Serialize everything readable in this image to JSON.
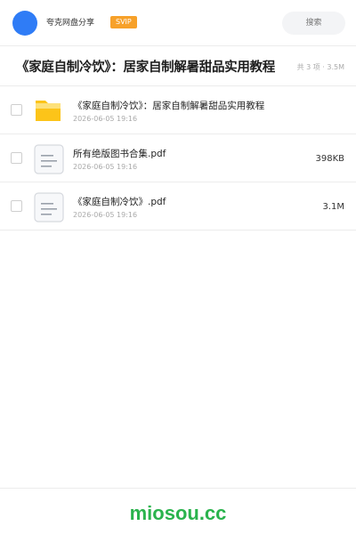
{
  "header": {
    "brand_name": "夸克网盘分享",
    "badge": "SVIP",
    "search_placeholder": "搜索"
  },
  "folder": {
    "title": "《家庭自制冷饮》：居家自制解暑甜品实用教程",
    "meta": "共 3 项 · 3.5M"
  },
  "files": [
    {
      "type": "folder",
      "name": "《家庭自制冷饮》：居家自制解暑甜品实用教程",
      "date": "2026-06-05 19:16",
      "size": ""
    },
    {
      "type": "pdf",
      "name": "所有绝版图书合集.pdf",
      "date": "2026-06-05 19:16",
      "size": "398KB"
    },
    {
      "type": "pdf",
      "name": "《家庭自制冷饮》.pdf",
      "date": "2026-06-05 19:16",
      "size": "3.1M"
    }
  ],
  "footer": {
    "watermark": "miosou.cc"
  },
  "colors": {
    "avatar": "#2f7cf6",
    "badge": "#f7a12a",
    "folder_icon": "#fcc419",
    "watermark": "#2ab34d"
  },
  "icons": {
    "folder": "folder-icon",
    "document": "document-icon"
  }
}
